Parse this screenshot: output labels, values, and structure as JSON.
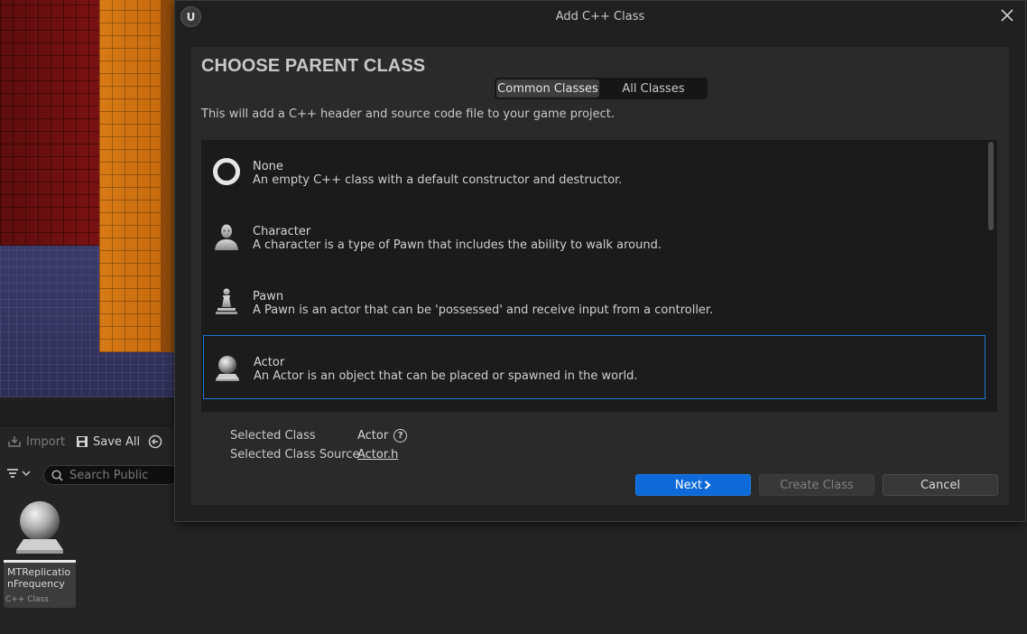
{
  "dialog": {
    "title": "Add C++ Class",
    "heading": "CHOOSE PARENT CLASS",
    "tabs": [
      {
        "label": "Common Classes",
        "active": true
      },
      {
        "label": "All Classes",
        "active": false
      }
    ],
    "subtitle": "This will add a C++ header and source code file to your game project.",
    "classes": [
      {
        "name": "None",
        "description": "An empty C++ class with a default constructor and destructor.",
        "icon": "ring-icon",
        "selected": false
      },
      {
        "name": "Character",
        "description": "A character is a type of Pawn that includes the ability to walk around.",
        "icon": "character-icon",
        "selected": false
      },
      {
        "name": "Pawn",
        "description": "A Pawn is an actor that can be 'possessed' and receive input from a controller.",
        "icon": "pawn-icon",
        "selected": false
      },
      {
        "name": "Actor",
        "description": "An Actor is an object that can be placed or spawned in the world.",
        "icon": "actor-sphere-icon",
        "selected": true
      }
    ],
    "selected_class_label": "Selected Class",
    "selected_class_value": "Actor",
    "selected_source_label": "Selected Class Source",
    "selected_source_value": "Actor.h",
    "buttons": {
      "next": "Next",
      "create": "Create Class",
      "cancel": "Cancel"
    },
    "accent_color": "#0e6ad8"
  },
  "content_browser": {
    "import_label": "Import",
    "save_all_label": "Save All",
    "search_placeholder": "Search Public",
    "asset": {
      "name": "MTReplicationFrequency",
      "type": "C++ Class"
    }
  }
}
